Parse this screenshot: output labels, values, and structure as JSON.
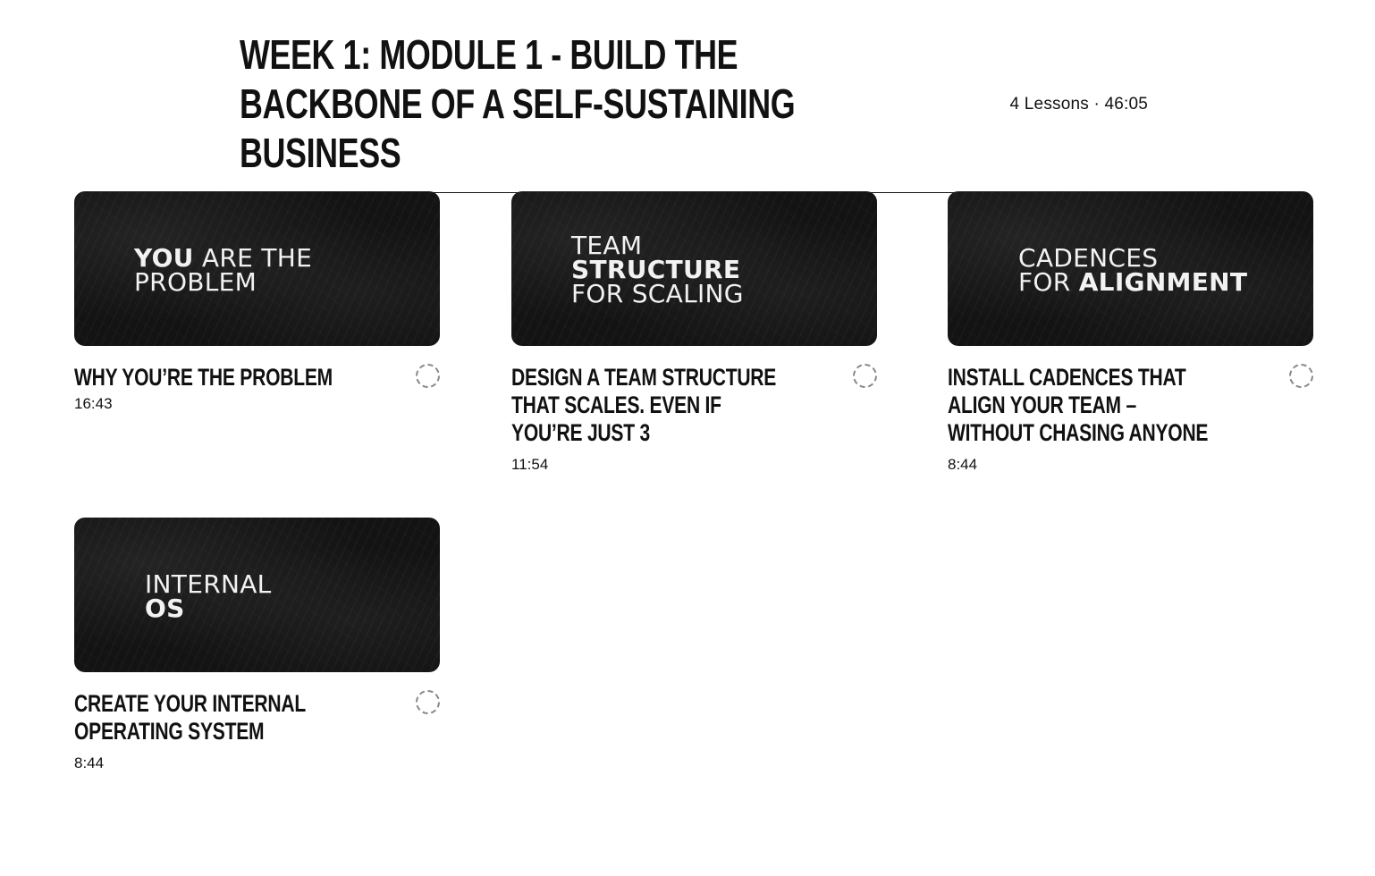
{
  "module": {
    "title": "WEEK 1: MODULE 1 - BUILD THE BACKBONE OF A SELF-SUSTAINING BUSINESS",
    "meta": "4 Lessons · 46:05"
  },
  "lessons": [
    {
      "thumb_line1_bold": "YOU",
      "thumb_line1_light": " ARE THE",
      "thumb_line2": "PROBLEM",
      "title": "WHY YOU’RE THE PROBLEM",
      "duration": "16:43",
      "status_icon": "progress-ring-icon"
    },
    {
      "thumb_line1": "TEAM",
      "thumb_line2": "STRUCTURE",
      "thumb_line3": "FOR SCALING",
      "title": "DESIGN A TEAM STRUCTURE THAT SCALES. EVEN IF YOU’RE JUST 3",
      "duration": "11:54",
      "status_icon": "progress-ring-icon"
    },
    {
      "thumb_line1": "CADENCES",
      "thumb_line2_light": "FOR ",
      "thumb_line2_bold": "ALIGNMENT",
      "title": "INSTALL CADENCES THAT ALIGN YOUR TEAM – WITHOUT CHASING ANYONE",
      "duration": "8:44",
      "status_icon": "progress-ring-icon"
    },
    {
      "thumb_line1": "INTERNAL",
      "thumb_line2": "OS",
      "title": "CREATE YOUR INTERNAL OPERATING SYSTEM",
      "duration": "8:44",
      "status_icon": "progress-ring-icon"
    }
  ]
}
